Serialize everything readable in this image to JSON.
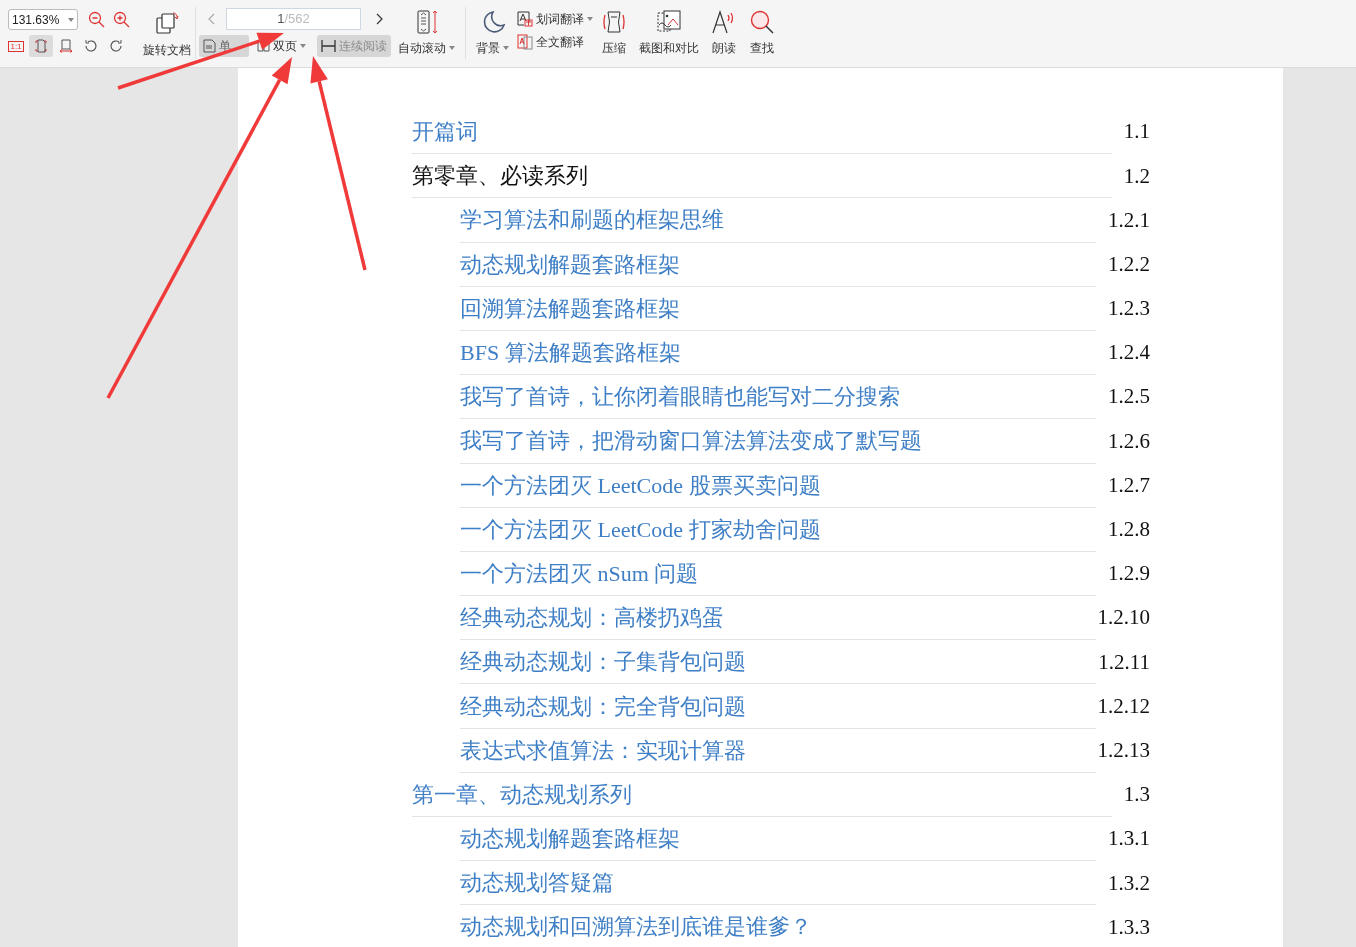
{
  "toolbar": {
    "zoom": {
      "value": "131.63%"
    },
    "view_icons": [
      {
        "kind": "actual",
        "label": "1:1",
        "selected": false
      },
      {
        "kind": "fitpage",
        "selected": true
      },
      {
        "kind": "fitwidth",
        "selected": false
      },
      {
        "kind": "rotl",
        "selected": false
      },
      {
        "kind": "rotr",
        "selected": false
      }
    ],
    "rotate_label": "旋转文档",
    "page_input": {
      "current": "1",
      "total": "/562"
    },
    "page_modes": [
      {
        "label": "单",
        "selected": true,
        "dropdown": false
      },
      {
        "label": "双页",
        "selected": false,
        "dropdown": true
      }
    ],
    "continuous": {
      "label": "连续阅读",
      "selected": true
    },
    "auto_scroll": "自动滚动",
    "background": "背景",
    "translate": [
      {
        "label": "划词翻译",
        "dropdown": true
      },
      {
        "label": "全文翻译",
        "dropdown": false
      }
    ],
    "tools": [
      {
        "kind": "compress",
        "label": "压缩"
      },
      {
        "kind": "screenshot",
        "label": "截图和对比"
      },
      {
        "kind": "read",
        "label": "朗读"
      },
      {
        "kind": "find",
        "label": "查找"
      }
    ]
  },
  "toc": [
    {
      "title": "开篇词",
      "number": "1.1",
      "linked": true
    },
    {
      "title": "第零章、必读系列",
      "number": "1.2",
      "linked": false,
      "children": [
        {
          "title": "学习算法和刷题的框架思维",
          "number": "1.2.1",
          "linked": true
        },
        {
          "title": "动态规划解题套路框架",
          "number": "1.2.2",
          "linked": true
        },
        {
          "title": "回溯算法解题套路框架",
          "number": "1.2.3",
          "linked": true
        },
        {
          "title": "BFS 算法解题套路框架",
          "number": "1.2.4",
          "linked": true
        },
        {
          "title": "我写了首诗，让你闭着眼睛也能写对二分搜索",
          "number": "1.2.5",
          "linked": true
        },
        {
          "title": "我写了首诗，把滑动窗口算法算法变成了默写题",
          "number": "1.2.6",
          "linked": true
        },
        {
          "title": "一个方法团灭 LeetCode 股票买卖问题",
          "number": "1.2.7",
          "linked": true
        },
        {
          "title": "一个方法团灭 LeetCode 打家劫舍问题",
          "number": "1.2.8",
          "linked": true
        },
        {
          "title": "一个方法团灭 nSum 问题",
          "number": "1.2.9",
          "linked": true
        },
        {
          "title": "经典动态规划：高楼扔鸡蛋",
          "number": "1.2.10",
          "linked": true
        },
        {
          "title": "经典动态规划：子集背包问题",
          "number": "1.2.11",
          "linked": true
        },
        {
          "title": "经典动态规划：完全背包问题",
          "number": "1.2.12",
          "linked": true
        },
        {
          "title": "表达式求值算法：实现计算器",
          "number": "1.2.13",
          "linked": true
        }
      ]
    },
    {
      "title": "第一章、动态规划系列",
      "number": "1.3",
      "linked": true,
      "children": [
        {
          "title": "动态规划解题套路框架",
          "number": "1.3.1",
          "linked": true
        },
        {
          "title": "动态规划答疑篇",
          "number": "1.3.2",
          "linked": true
        },
        {
          "title": "动态规划和回溯算法到底谁是谁爹？",
          "number": "1.3.3",
          "linked": true
        }
      ]
    }
  ],
  "annotations": [
    {
      "kind": "arrow"
    },
    {
      "kind": "arrow"
    },
    {
      "kind": "arrow"
    }
  ]
}
